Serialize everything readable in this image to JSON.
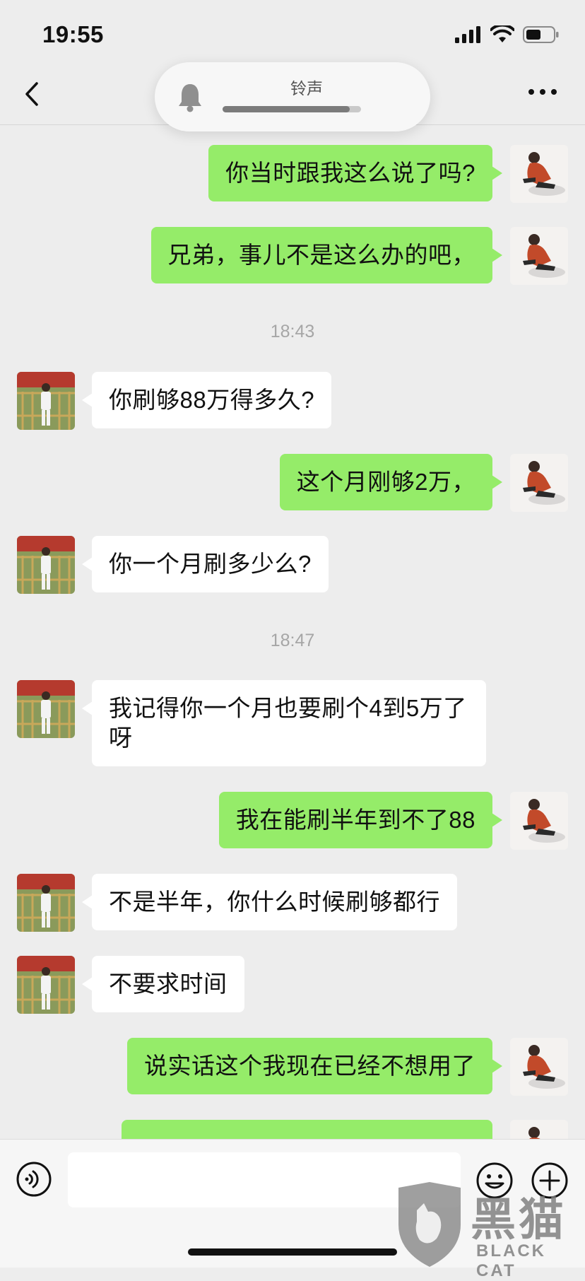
{
  "status_bar": {
    "time": "19:55"
  },
  "ringtone": {
    "label": "铃声",
    "progress": 0.92
  },
  "timestamps": [
    "18:43",
    "18:47"
  ],
  "messages": [
    {
      "sender": "me",
      "text": "你当时跟我这么说了吗?"
    },
    {
      "sender": "me",
      "text": "兄弟，事儿不是这么办的吧，"
    },
    {
      "sender": "other",
      "text": "你刷够88万得多久?"
    },
    {
      "sender": "me",
      "text": "这个月刚够2万，"
    },
    {
      "sender": "other",
      "text": "你一个月刷多少么?"
    },
    {
      "sender": "other",
      "text": "我记得你一个月也要刷个4到5万了呀"
    },
    {
      "sender": "me",
      "text": "我在能刷半年到不了88"
    },
    {
      "sender": "other",
      "text": "不是半年，你什么时候刷够都行"
    },
    {
      "sender": "other",
      "text": "不要求时间"
    },
    {
      "sender": "me",
      "text": "说实话这个我现在已经不想用了"
    }
  ],
  "input": {
    "value": "",
    "placeholder": ""
  },
  "watermark": {
    "cn": "黑猫",
    "en": "BLACK CAT"
  },
  "colors": {
    "my_bubble": "#95ec69",
    "other_bubble": "#ffffff",
    "background": "#ededed"
  }
}
